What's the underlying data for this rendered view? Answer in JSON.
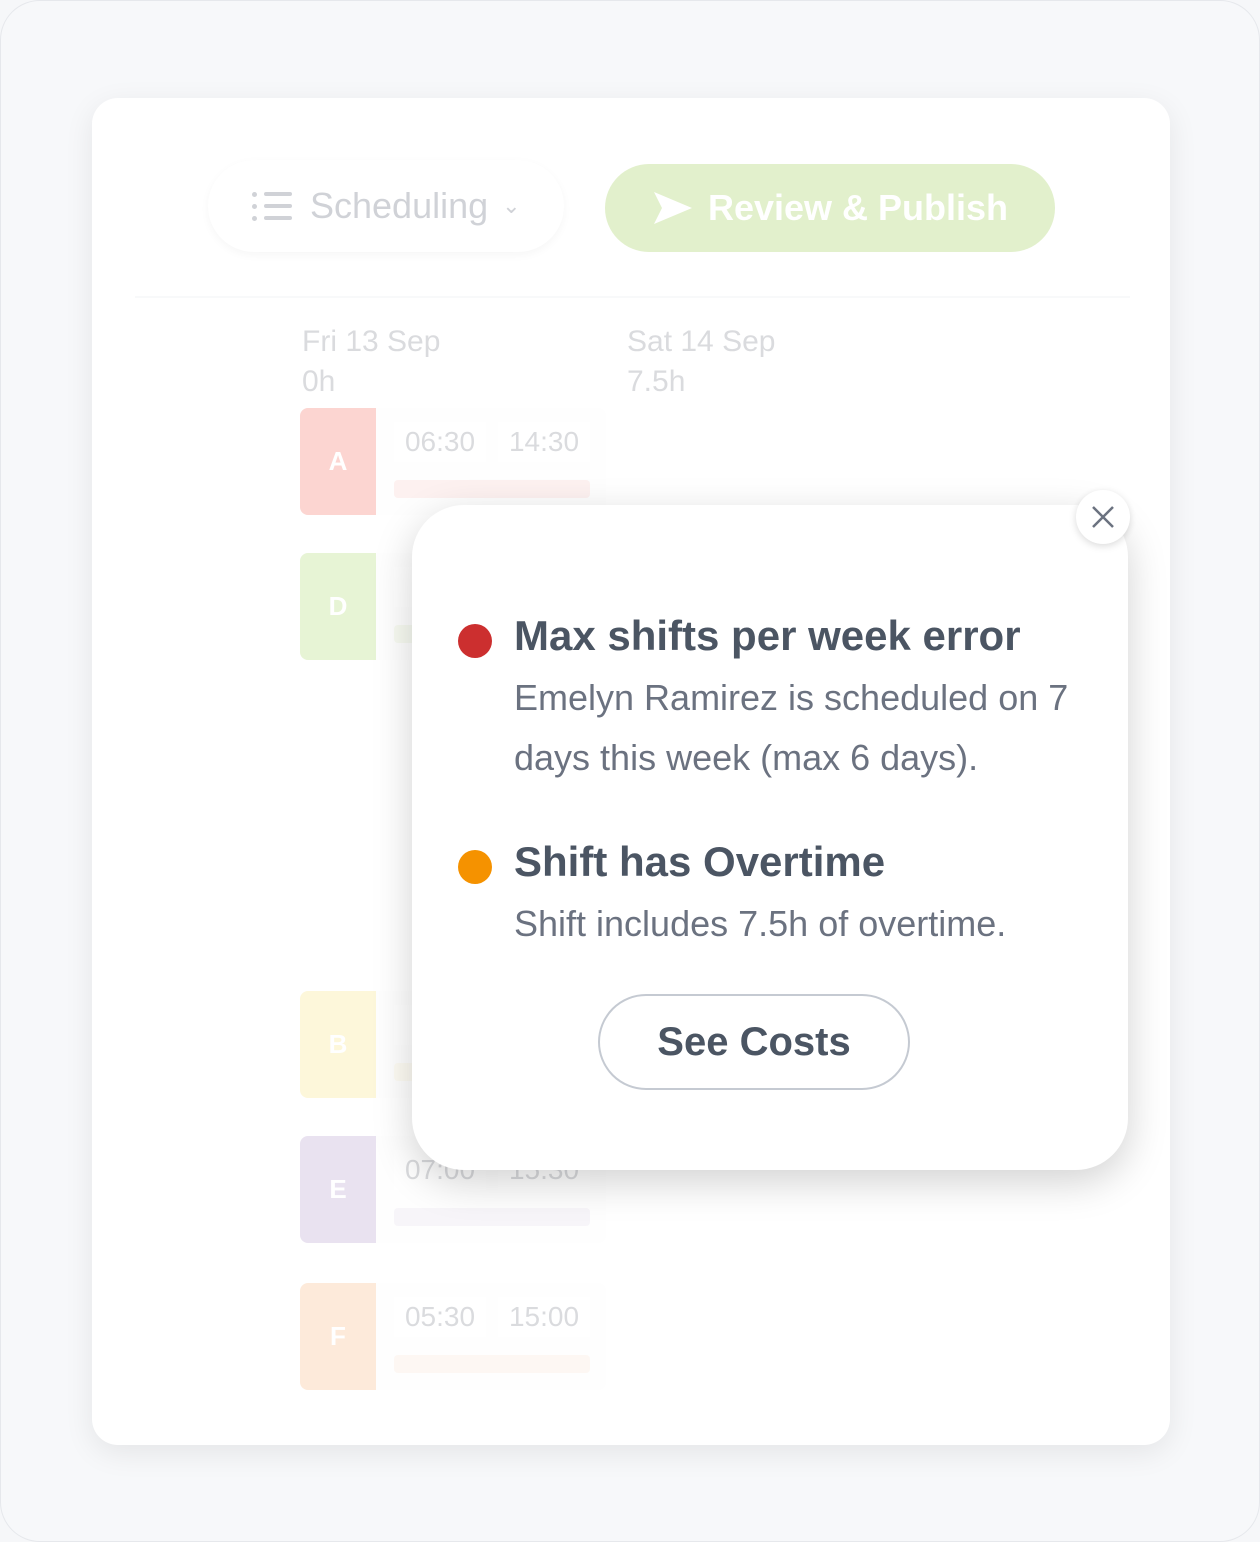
{
  "toolbar": {
    "view_label": "Scheduling",
    "view_icon": "list-icon",
    "publish_label": "Review & Publish",
    "publish_icon": "send-icon",
    "publish_color": "#a4d05f"
  },
  "days": [
    {
      "date": "Fri 13 Sep",
      "hours": "0h"
    },
    {
      "date": "Sat 14 Sep",
      "hours": "7.5h"
    }
  ],
  "shifts": [
    {
      "tag": "A",
      "start": "06:30",
      "end": "14:30",
      "color": "#f47c6e"
    },
    {
      "tag": "D",
      "start": "",
      "end": "",
      "color": "#b5dc7c"
    },
    {
      "tag": "B",
      "start": "",
      "end": "",
      "color": "#f7e48a"
    },
    {
      "tag": "E",
      "start": "07:00",
      "end": "15:30",
      "color": "#b9a3d0"
    },
    {
      "tag": "F",
      "start": "05:30",
      "end": "15:00",
      "color": "#f9be8a"
    }
  ],
  "popover": {
    "issues": [
      {
        "title": "Max shifts per week error",
        "description": "Emelyn Ramirez is scheduled on 7 days this week (max 6 days).",
        "severity": "error",
        "color": "#cc2f2f"
      },
      {
        "title": "Shift has Overtime",
        "description": "Shift includes 7.5h of overtime.",
        "severity": "warning",
        "color": "#f59200"
      }
    ],
    "button_label": "See Costs",
    "close_icon": "close-icon"
  }
}
